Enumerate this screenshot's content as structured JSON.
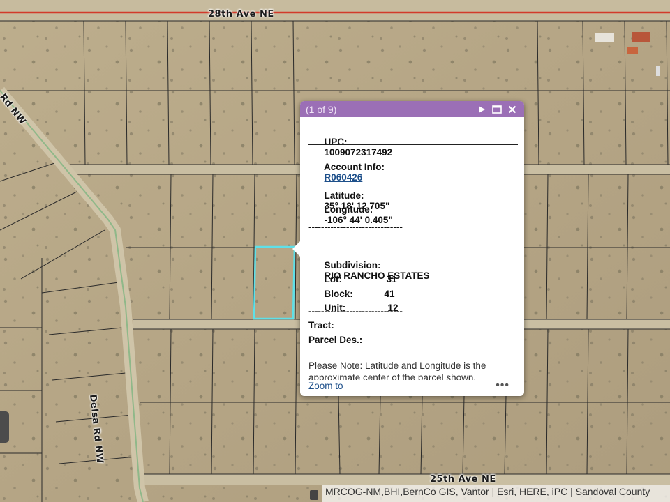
{
  "map": {
    "roads": {
      "top_road": "28th Ave NE",
      "bottom_road": "25th Ave NE",
      "diagonal_road": "Delsa Rd NW",
      "corner_road": "Rd NW"
    },
    "attribution": "MRCOG-NM,BHI,BernCo GIS, Vantor | Esri, HERE, iPC | Sandoval County"
  },
  "popup": {
    "count": "(1 of 9)",
    "upc_label": "UPC:",
    "upc_value": "1009072317492",
    "account_label": "Account Info:",
    "account_value": "R060426",
    "latitude_label": "Latitude:",
    "latitude_value": "35° 18' 12.705\"",
    "longitude_label": "Longitude:",
    "longitude_value": "-106° 44' 0.405\"",
    "separator": "------------------------------",
    "subdivision_label": "Subdivision:",
    "subdivision_value": "RIO RANCHO ESTATES",
    "lot_label": "Lot:",
    "lot_value": "31",
    "block_label": "Block:",
    "block_value": "41",
    "unit_label": "Unit:",
    "unit_value": "12",
    "tract_label": "Tract:",
    "parcel_des_label": "Parcel Des.:",
    "note": "Please Note: Latitude and Longitude is the approximate center of the parcel shown.",
    "zoom_to": "Zoom to",
    "more": "•••"
  },
  "colors": {
    "header": "#9b6fb6",
    "highlight": "#5ee0e8",
    "link": "#1d4f8a",
    "road_line": "#d23a2a"
  }
}
